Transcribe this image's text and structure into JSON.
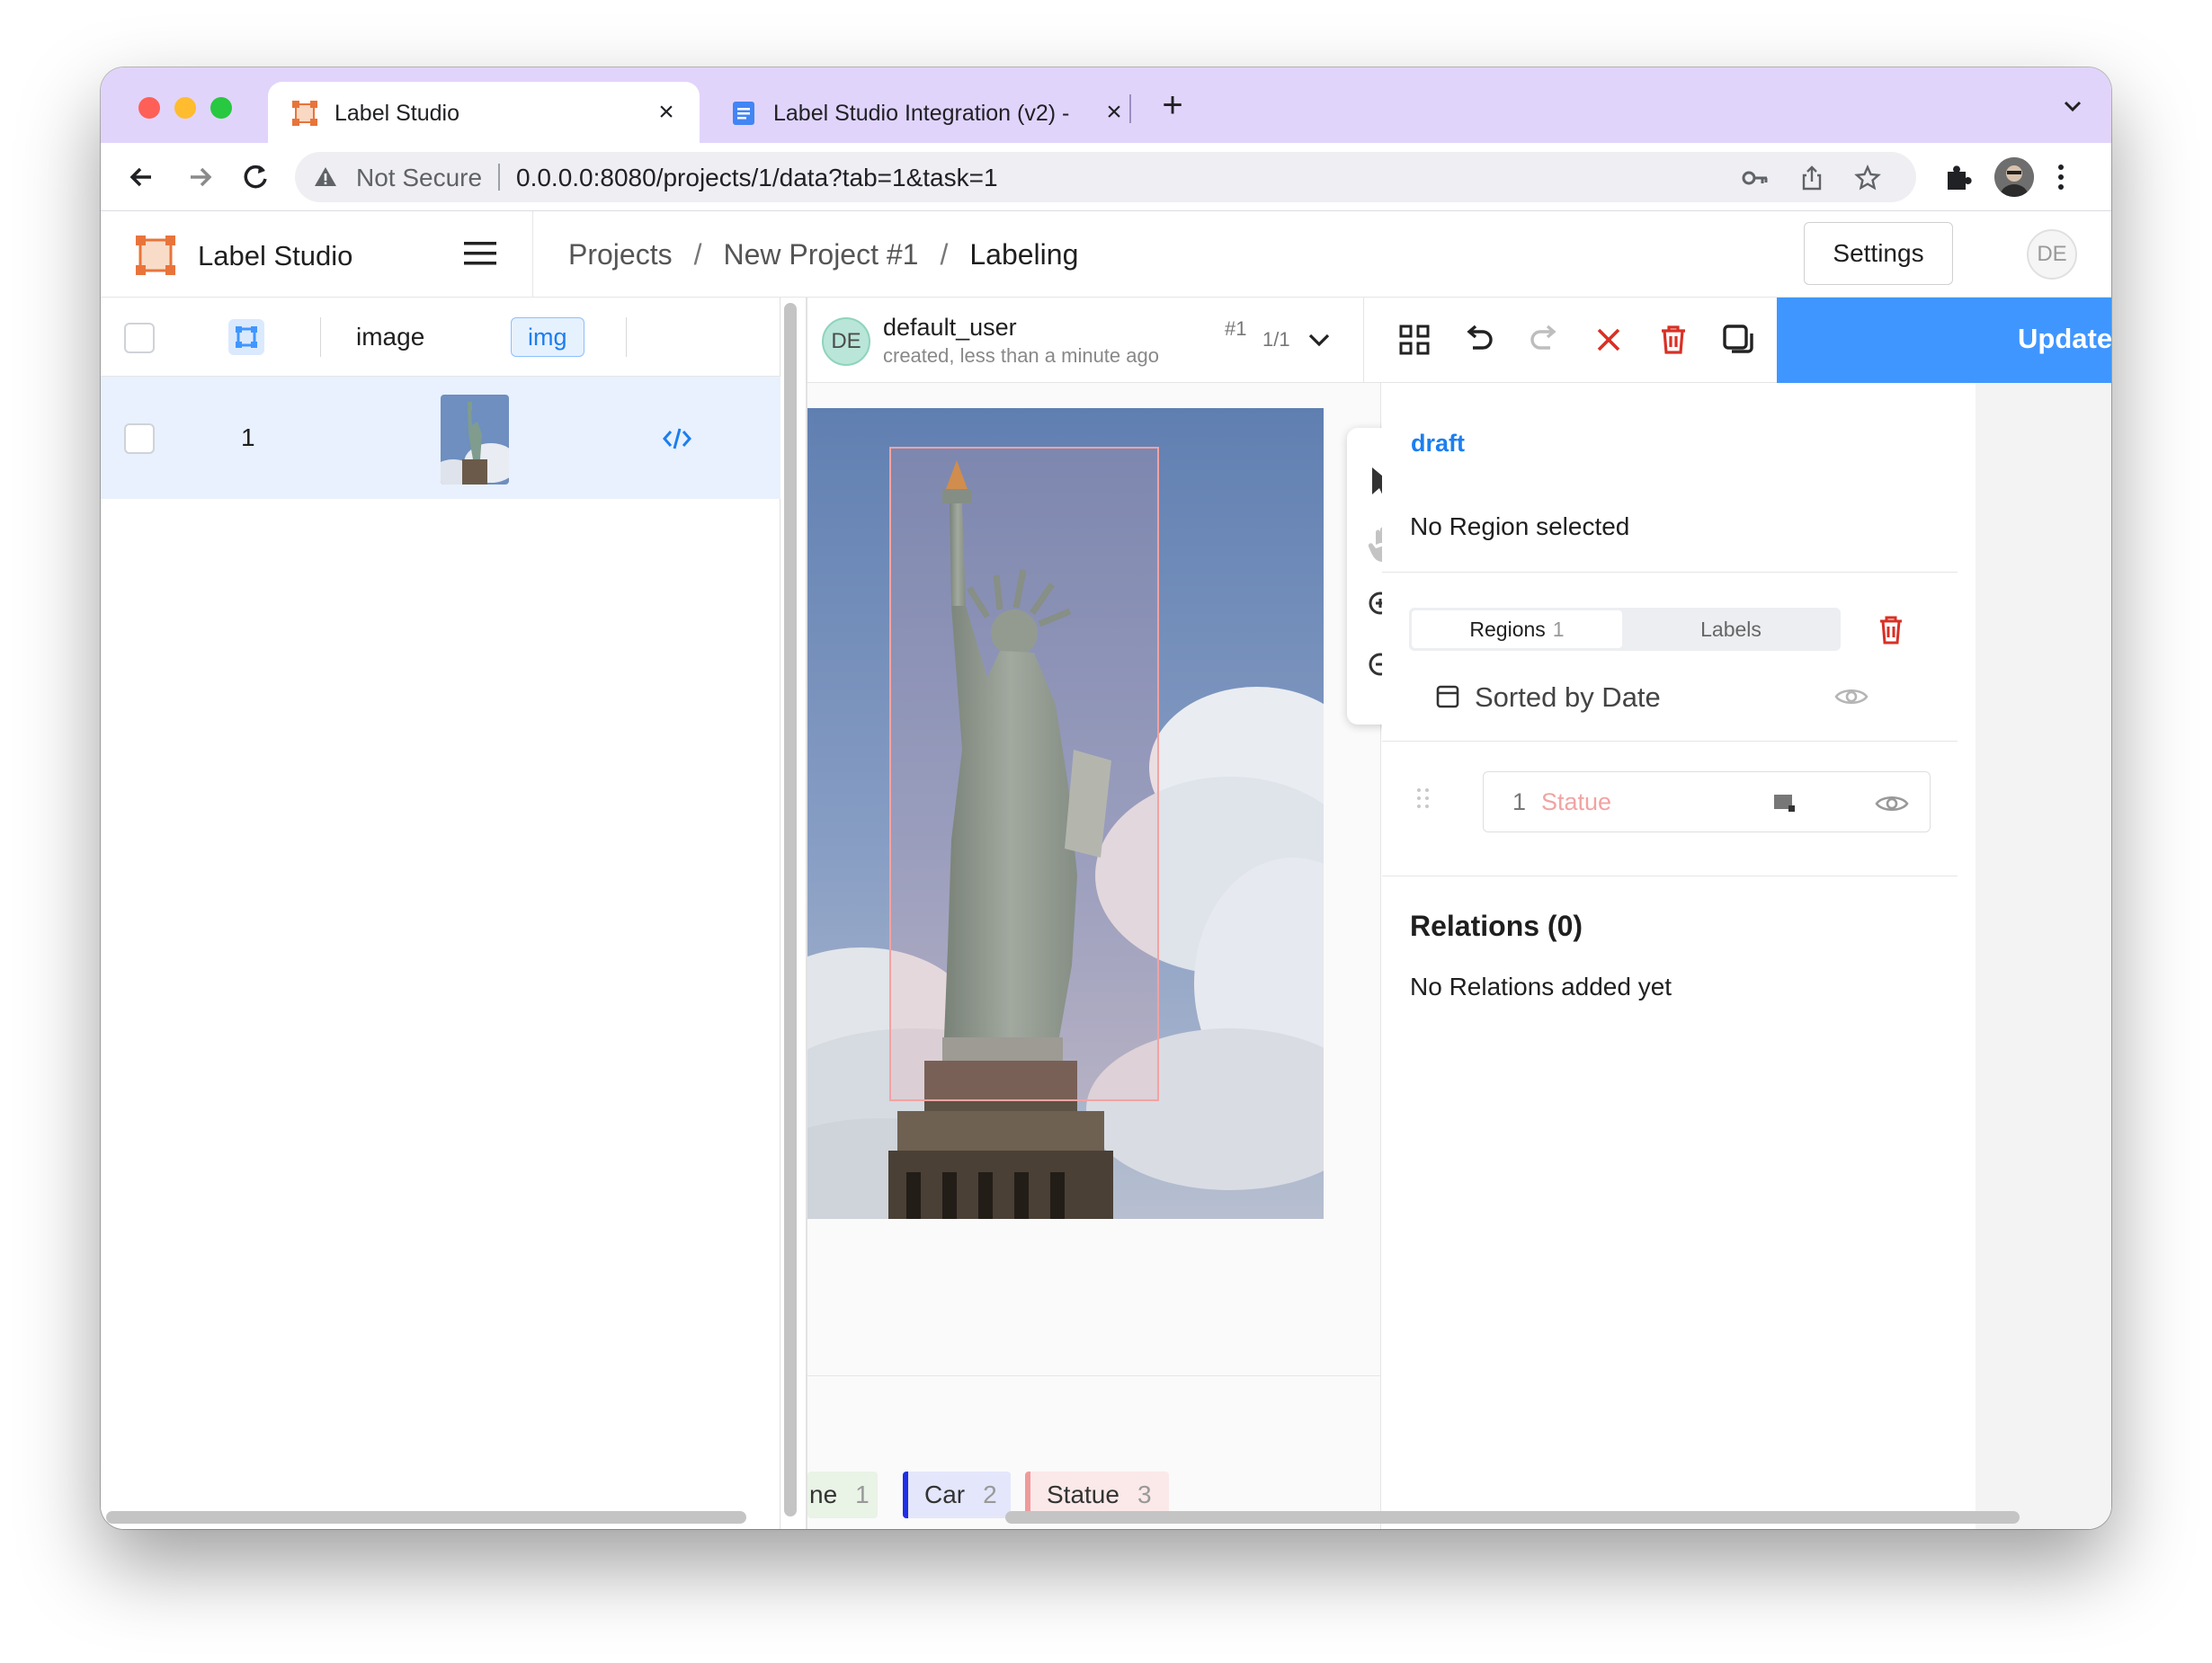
{
  "browser": {
    "tabs": [
      {
        "title": "Label Studio",
        "icon": "label-studio-logo-icon",
        "active": true
      },
      {
        "title": "Label Studio Integration (v2) -",
        "icon": "docs-icon",
        "active": false
      }
    ],
    "new_tab": "+",
    "address_warning": "Not Secure",
    "address_url": "0.0.0.0:8080/projects/1/data?tab=1&task=1"
  },
  "header": {
    "app_name": "Label Studio",
    "breadcrumbs": [
      "Projects",
      "New Project #1",
      "Labeling"
    ],
    "settings_label": "Settings",
    "user_initials": "DE"
  },
  "data_manager": {
    "columns": {
      "image": "image",
      "type_badge": "img"
    },
    "rows": [
      {
        "id": "1",
        "thumb": "statue-thumbnail",
        "code_icon": "code-icon"
      }
    ]
  },
  "annotation": {
    "avatar": "DE",
    "user": "default_user",
    "number": "#1",
    "created": "created, less than a minute ago",
    "count": "1/1",
    "update_label": "Update"
  },
  "sidebar": {
    "status": "draft",
    "no_region": "No Region selected",
    "tabs": [
      {
        "label": "Regions",
        "count": "1"
      },
      {
        "label": "Labels",
        "count": ""
      }
    ],
    "sort_label": "Sorted by Date",
    "region": {
      "index": "1",
      "label": "Statue"
    },
    "relations_title": "Relations (0)",
    "relations_empty": "No Relations added yet"
  },
  "labels": [
    {
      "text": "ne",
      "hotkey": "1",
      "color": "#a8d5a2"
    },
    {
      "text": "Car",
      "hotkey": "2",
      "color": "#1f2fe6"
    },
    {
      "text": "Statue",
      "hotkey": "3",
      "color": "#f09a9a"
    }
  ],
  "colors": {
    "accent": "#4096ff",
    "tab_strip": "#e1d4fb",
    "region": "#f2a3a3",
    "danger": "#d93025"
  }
}
